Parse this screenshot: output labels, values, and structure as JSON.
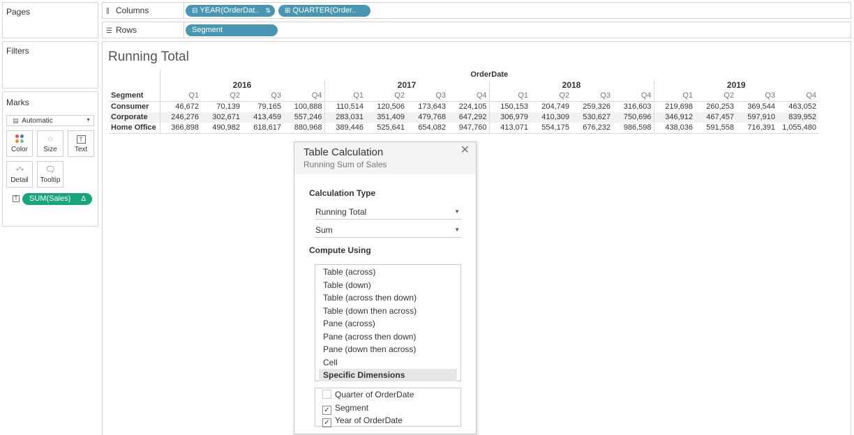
{
  "cards": {
    "pages": "Pages",
    "filters": "Filters",
    "marks": "Marks",
    "mark_type": "Automatic",
    "buttons": {
      "color": "Color",
      "size": "Size",
      "text": "Text",
      "detail": "Detail",
      "tooltip": "Tooltip"
    },
    "text_field_pill": "SUM(Sales)",
    "text_field_pill_delta": "Δ"
  },
  "shelves": {
    "columns_label": "Columns",
    "rows_label": "Rows",
    "columns_pills": [
      "YEAR(OrderDat..",
      "QUARTER(Order.."
    ],
    "rows_pill": "Segment"
  },
  "view": {
    "title": "Running Total",
    "column_header": "OrderDate",
    "row_header": "Segment",
    "years": [
      "2016",
      "2017",
      "2018",
      "2019"
    ],
    "quarters": [
      "Q1",
      "Q2",
      "Q3",
      "Q4"
    ],
    "rows": [
      {
        "segment": "Consumer",
        "values": [
          "46,672",
          "70,139",
          "79,165",
          "100,888",
          "110,514",
          "120,506",
          "173,643",
          "224,105",
          "150,153",
          "204,749",
          "259,326",
          "316,603",
          "219,698",
          "260,253",
          "369,544",
          "463,052"
        ]
      },
      {
        "segment": "Corporate",
        "values": [
          "246,276",
          "302,671",
          "413,459",
          "557,246",
          "283,031",
          "351,409",
          "479,768",
          "647,292",
          "306,979",
          "410,309",
          "530,627",
          "750,696",
          "346,912",
          "467,457",
          "597,910",
          "839,952"
        ]
      },
      {
        "segment": "Home Office",
        "values": [
          "366,898",
          "490,982",
          "618,617",
          "880,968",
          "389,446",
          "525,641",
          "654,082",
          "947,760",
          "413,071",
          "554,175",
          "676,232",
          "986,598",
          "438,036",
          "591,558",
          "716,391",
          "1,055,480"
        ]
      }
    ]
  },
  "dialog": {
    "title": "Table Calculation",
    "subtitle": "Running Sum of Sales",
    "calc_type_label": "Calculation Type",
    "calc_type_value": "Running Total",
    "aggregation_value": "Sum",
    "compute_using_label": "Compute Using",
    "compute_options": [
      "Table (across)",
      "Table (down)",
      "Table (across then down)",
      "Table (down then across)",
      "Pane (across)",
      "Pane (across then down)",
      "Pane (down then across)",
      "Cell",
      "Specific Dimensions"
    ],
    "selected_option": "Specific Dimensions",
    "dimensions": [
      {
        "label": "Quarter of OrderDate",
        "checked": false
      },
      {
        "label": "Segment",
        "checked": true
      },
      {
        "label": "Year of OrderDate",
        "checked": true
      }
    ]
  },
  "colors": {
    "pill_blue": "#4996b2",
    "pill_green": "#18a57b",
    "band": "#f2f2f2"
  }
}
